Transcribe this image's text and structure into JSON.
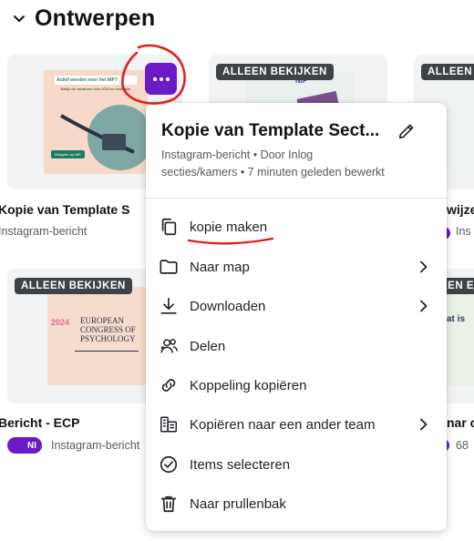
{
  "section": {
    "title": "Ontwerpen"
  },
  "cards": [
    {
      "title": "Kopie van Template S",
      "subtitle": "Instagram-bericht"
    },
    {
      "badge": "ALLEEN BEKIJKEN"
    },
    {
      "badge": "ALLEEN E",
      "title": "wijze",
      "subtitle": "Ins"
    },
    {
      "badge": "ALLEEN BEKIJKEN",
      "title": "Bericht - ECP",
      "subtitle": "Instagram-bericht",
      "avatar": "NI"
    },
    {
      "badge": "EEN E",
      "title": "nar c",
      "subtitle": "68"
    }
  ],
  "thumbs": {
    "t1_headline": "Actief worden voor het NIP?",
    "t1_sub": "Bekijk de vacatures voor 2024 en solliciteer",
    "t1_cta": "Reageer op NIP",
    "t2_logo": "NIP",
    "t4_year": "2024",
    "t4_l1": "EUROPEAN",
    "t4_l2": "CONGRESS OF",
    "t4_l3": "PSYCHOLOGY",
    "t5_title": "at is"
  },
  "menu": {
    "title": "Kopie van Template Sect...",
    "meta_line1": "Instagram-bericht • Door Inlog",
    "meta_line2": "secties/kamers • 7 minuten geleden bewerkt",
    "items": [
      {
        "label": "kopie maken",
        "icon": "copy-icon"
      },
      {
        "label": "Naar map",
        "icon": "folder-icon"
      },
      {
        "label": "Downloaden",
        "icon": "download-icon"
      },
      {
        "label": "Delen",
        "icon": "share-users-icon"
      },
      {
        "label": "Koppeling kopiëren",
        "icon": "link-icon"
      },
      {
        "label": "Kopiëren naar een ander team",
        "icon": "team-copy-icon"
      },
      {
        "label": "Items selecteren",
        "icon": "check-circle-icon"
      },
      {
        "label": "Naar prullenbak",
        "icon": "trash-icon"
      }
    ]
  },
  "colors": {
    "accent": "#6a1bc4",
    "annotation": "#e0201c",
    "badge": "#3d4247"
  }
}
